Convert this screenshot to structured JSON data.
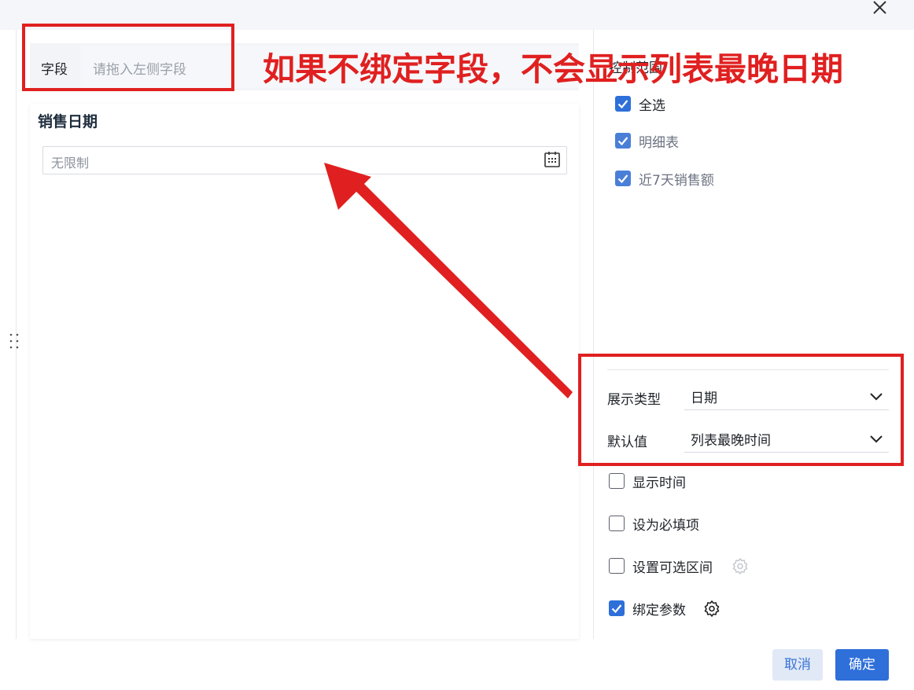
{
  "field": {
    "label": "字段",
    "placeholder": "请拖入左侧字段"
  },
  "preview": {
    "title": "销售日期",
    "date_placeholder": "无限制"
  },
  "scope": {
    "title": "控制范围",
    "items": [
      {
        "label": "全选",
        "checked": true
      },
      {
        "label": "明细表",
        "checked": true
      },
      {
        "label": "近7天销售额",
        "checked": true
      }
    ]
  },
  "settings": {
    "display_type_label": "展示类型",
    "display_type_value": "日期",
    "default_value_label": "默认值",
    "default_value_value": "列表最晚时间",
    "options": [
      {
        "label": "显示时间",
        "checked": false
      },
      {
        "label": "设为必填项",
        "checked": false
      },
      {
        "label": "设置可选区间",
        "checked": false
      },
      {
        "label": "绑定参数",
        "checked": true
      }
    ]
  },
  "footer": {
    "cancel_label": "取消",
    "ok_label": "确定"
  },
  "annotation": {
    "text": "如果不绑定字段，不会显示列表最晚日期"
  },
  "colors": {
    "accent": "#2e6fd9",
    "annotation": "#e02020"
  }
}
